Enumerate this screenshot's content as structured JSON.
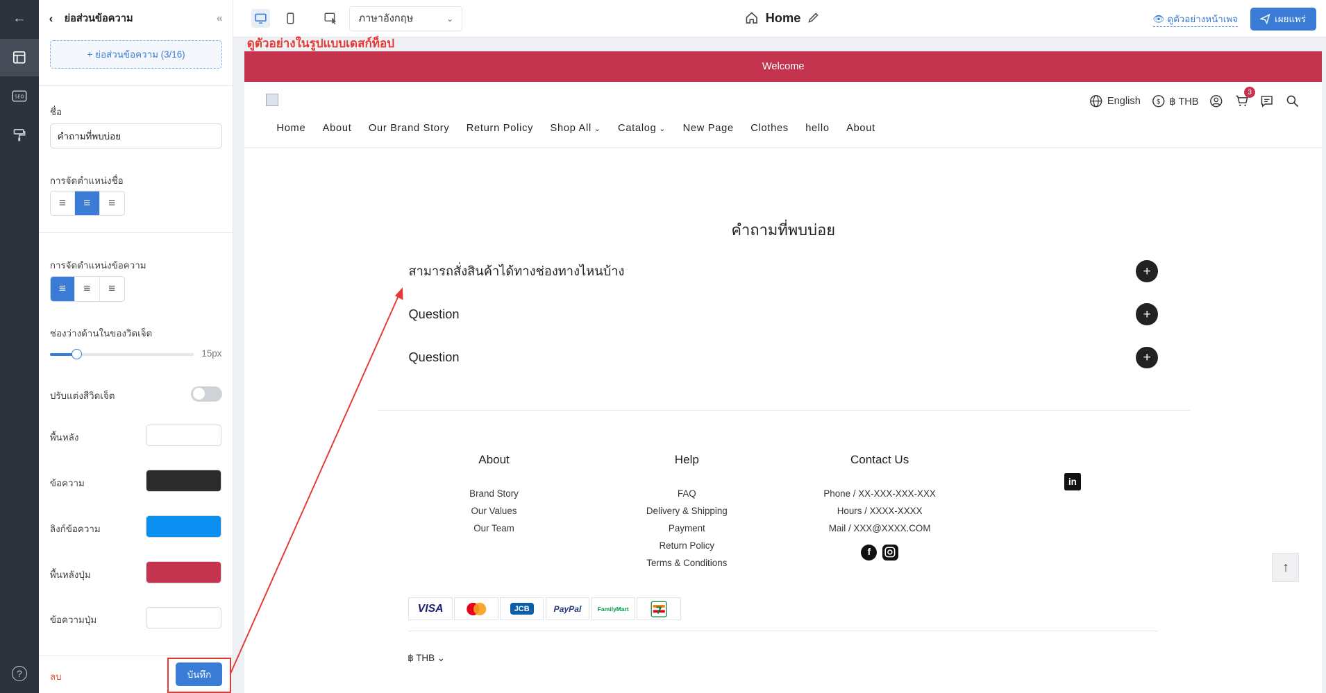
{
  "sidebar": {
    "title": "ย่อส่วนข้อความ",
    "add_button": "+ ย่อส่วนข้อความ (3/16)",
    "name_label": "ชื่อ",
    "name_value": "คำถามที่พบบ่อย",
    "title_align_label": "การจัดตำแหน่งชื่อ",
    "text_align_label": "การจัดตำแหน่งข้อความ",
    "padding_label": "ช่องว่างด้านในของวิดเจ็ต",
    "padding_value": "15px",
    "padding_level": 0.15,
    "custom_color_label": "ปรับแต่งสีวิดเจ็ต",
    "background_label": "พื้นหลัง",
    "text_label": "ข้อความ",
    "link_label": "ลิงก์ข้อความ",
    "button_bg_label": "พื้นหลังปุ่ม",
    "button_text_label": "ข้อความปุ่ม",
    "delete_label": "ลบ",
    "save_label": "บันทึก"
  },
  "colors": {
    "background": "#ffffff",
    "text": "#2b2b2b",
    "link": "#0a8ff0",
    "button_bg": "#c4344f",
    "button_text": "#ffffff",
    "accent": "#3a7bd5"
  },
  "topbar": {
    "language": "ภาษาอังกฤษ",
    "page_title": "Home",
    "preview_label": "ดูตัวอย่างหน้าเพจ",
    "publish_label": "เผยแพร่"
  },
  "annotation": "ดูตัวอย่างในรูปแบบเดสก์ท็อป",
  "site": {
    "banner": "Welcome",
    "language": "English",
    "currency": "฿ THB",
    "cart_count": "3",
    "nav": [
      "Home",
      "About",
      "Our Brand Story",
      "Return Policy",
      "Shop All",
      "Catalog",
      "New Page",
      "Clothes",
      "hello",
      "About"
    ],
    "faq_title": "คำถามที่พบบ่อย",
    "faq": [
      "สามารถสั่งสินค้าได้ทางช่องทางไหนบ้าง",
      "Question",
      "Question"
    ],
    "footer": {
      "about_title": "About",
      "about_links": [
        "Brand Story",
        "Our Values",
        "Our Team"
      ],
      "help_title": "Help",
      "help_links": [
        "FAQ",
        "Delivery & Shipping",
        "Payment",
        "Return Policy",
        "Terms & Conditions"
      ],
      "contact_title": "Contact Us",
      "contact_lines": [
        "Phone / XX-XXX-XXX-XXX",
        "Hours / XXXX-XXXX",
        "Mail / XXX@XXXX.COM"
      ]
    },
    "payments": [
      "VISA",
      "Mastercard",
      "JCB",
      "PayPal",
      "FamilyMart",
      "7-Eleven"
    ],
    "footer_currency": "฿ THB"
  }
}
